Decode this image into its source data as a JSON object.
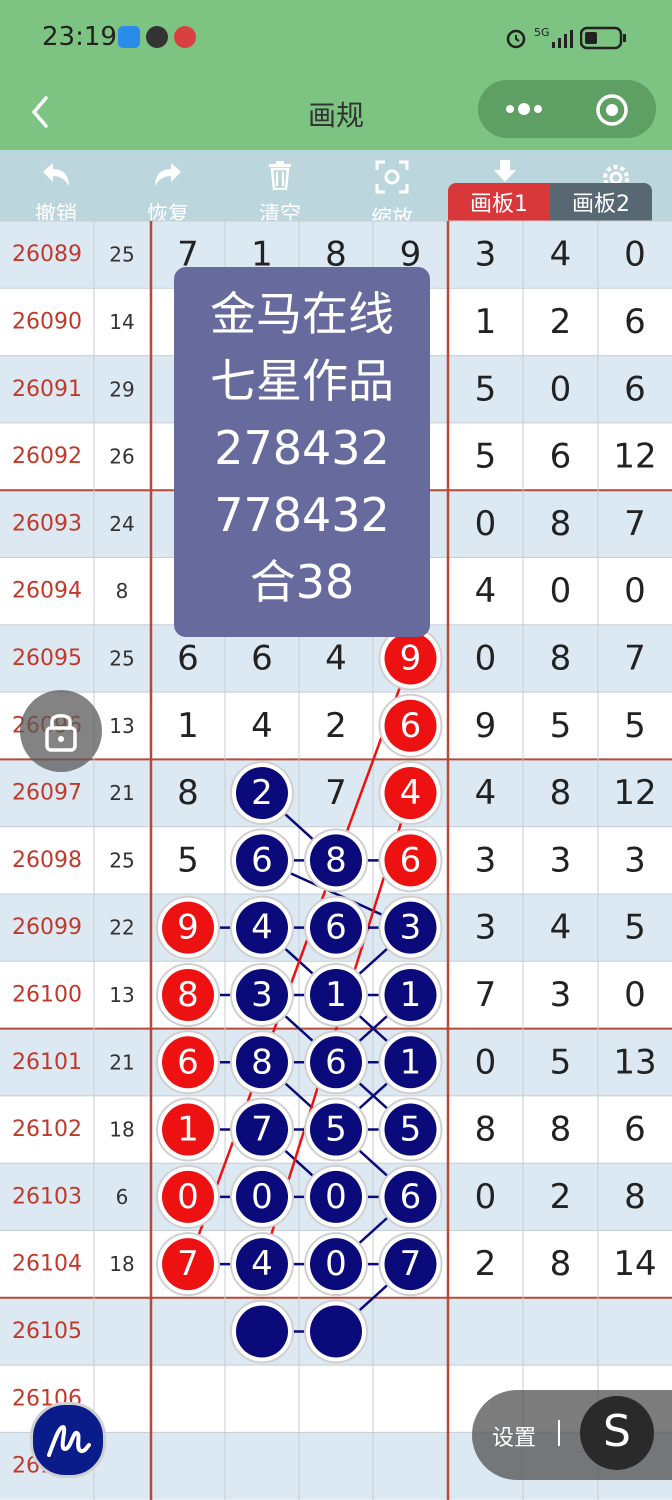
{
  "status": {
    "time": "23:19",
    "network": "5G"
  },
  "nav": {
    "title": "画规",
    "more_icon": "dots-icon",
    "close_icon": "target-icon"
  },
  "toolbar": {
    "undo": "撤销",
    "redo": "恢复",
    "clear": "清空",
    "zoom": "缩放",
    "tab1": "画板1",
    "tab2": "画板2",
    "settings_hidden": "设置"
  },
  "overlay": {
    "lines": [
      "金马在线",
      "七星作品",
      "278432",
      "778432",
      "合38"
    ]
  },
  "rows": [
    {
      "id": "26089",
      "sum": "25",
      "d": [
        "7",
        "1",
        "8",
        "9"
      ],
      "r": [
        "3",
        "4",
        "0"
      ]
    },
    {
      "id": "26090",
      "sum": "14",
      "d": [
        "",
        "",
        "",
        ""
      ],
      "r": [
        "1",
        "2",
        "6"
      ]
    },
    {
      "id": "26091",
      "sum": "29",
      "d": [
        "",
        "",
        "",
        ""
      ],
      "r": [
        "5",
        "0",
        "6"
      ]
    },
    {
      "id": "26092",
      "sum": "26",
      "d": [
        "",
        "",
        "",
        ""
      ],
      "r": [
        "5",
        "6",
        "12"
      ]
    },
    {
      "id": "26093",
      "sum": "24",
      "d": [
        "",
        "",
        "",
        ""
      ],
      "r": [
        "0",
        "8",
        "7"
      ]
    },
    {
      "id": "26094",
      "sum": "8",
      "d": [
        "",
        "",
        "",
        ""
      ],
      "r": [
        "4",
        "0",
        "0"
      ]
    },
    {
      "id": "26095",
      "sum": "25",
      "d": [
        "6",
        "6",
        "4",
        "9"
      ],
      "r": [
        "0",
        "8",
        "7"
      ]
    },
    {
      "id": "26096",
      "sum": "13",
      "d": [
        "1",
        "4",
        "2",
        "6"
      ],
      "r": [
        "9",
        "5",
        "5"
      ]
    },
    {
      "id": "26097",
      "sum": "21",
      "d": [
        "8",
        "2",
        "7",
        "4"
      ],
      "r": [
        "4",
        "8",
        "12"
      ]
    },
    {
      "id": "26098",
      "sum": "25",
      "d": [
        "5",
        "6",
        "8",
        "6"
      ],
      "r": [
        "3",
        "3",
        "3"
      ]
    },
    {
      "id": "26099",
      "sum": "22",
      "d": [
        "9",
        "4",
        "6",
        "3"
      ],
      "r": [
        "3",
        "4",
        "5"
      ]
    },
    {
      "id": "26100",
      "sum": "13",
      "d": [
        "8",
        "3",
        "1",
        "1"
      ],
      "r": [
        "7",
        "3",
        "0"
      ]
    },
    {
      "id": "26101",
      "sum": "21",
      "d": [
        "6",
        "8",
        "6",
        "1"
      ],
      "r": [
        "0",
        "5",
        "13"
      ]
    },
    {
      "id": "26102",
      "sum": "18",
      "d": [
        "1",
        "7",
        "5",
        "5"
      ],
      "r": [
        "8",
        "8",
        "6"
      ]
    },
    {
      "id": "26103",
      "sum": "6",
      "d": [
        "0",
        "0",
        "0",
        "6"
      ],
      "r": [
        "0",
        "2",
        "8"
      ]
    },
    {
      "id": "26104",
      "sum": "18",
      "d": [
        "7",
        "4",
        "0",
        "7"
      ],
      "r": [
        "2",
        "8",
        "14"
      ]
    },
    {
      "id": "26105",
      "sum": "",
      "d": [
        "",
        "",
        "",
        ""
      ],
      "r": [
        "",
        "",
        ""
      ]
    },
    {
      "id": "26106",
      "sum": "",
      "d": [
        "",
        "",
        "",
        ""
      ],
      "r": [
        "",
        "",
        ""
      ]
    },
    {
      "id": "26107",
      "sum": "",
      "d": [
        "",
        "",
        "",
        ""
      ],
      "r": [
        "",
        "",
        ""
      ]
    }
  ],
  "circles": [
    {
      "row": 6,
      "col": 3,
      "color": "red"
    },
    {
      "row": 7,
      "col": 3,
      "color": "red"
    },
    {
      "row": 8,
      "col": 1,
      "color": "navy"
    },
    {
      "row": 8,
      "col": 3,
      "color": "red"
    },
    {
      "row": 9,
      "col": 1,
      "color": "navy"
    },
    {
      "row": 9,
      "col": 2,
      "color": "navy"
    },
    {
      "row": 9,
      "col": 3,
      "color": "red"
    },
    {
      "row": 10,
      "col": 0,
      "color": "red"
    },
    {
      "row": 10,
      "col": 1,
      "color": "navy"
    },
    {
      "row": 10,
      "col": 2,
      "color": "navy"
    },
    {
      "row": 10,
      "col": 3,
      "color": "navy"
    },
    {
      "row": 11,
      "col": 0,
      "color": "red"
    },
    {
      "row": 11,
      "col": 1,
      "color": "navy"
    },
    {
      "row": 11,
      "col": 2,
      "color": "navy"
    },
    {
      "row": 11,
      "col": 3,
      "color": "navy"
    },
    {
      "row": 12,
      "col": 0,
      "color": "red"
    },
    {
      "row": 12,
      "col": 1,
      "color": "navy"
    },
    {
      "row": 12,
      "col": 2,
      "color": "navy"
    },
    {
      "row": 12,
      "col": 3,
      "color": "navy"
    },
    {
      "row": 13,
      "col": 0,
      "color": "red"
    },
    {
      "row": 13,
      "col": 1,
      "color": "navy"
    },
    {
      "row": 13,
      "col": 2,
      "color": "navy"
    },
    {
      "row": 13,
      "col": 3,
      "color": "navy"
    },
    {
      "row": 14,
      "col": 0,
      "color": "red"
    },
    {
      "row": 14,
      "col": 1,
      "color": "navy"
    },
    {
      "row": 14,
      "col": 2,
      "color": "navy"
    },
    {
      "row": 14,
      "col": 3,
      "color": "navy"
    },
    {
      "row": 15,
      "col": 0,
      "color": "red"
    },
    {
      "row": 15,
      "col": 1,
      "color": "navy"
    },
    {
      "row": 15,
      "col": 2,
      "color": "navy"
    },
    {
      "row": 15,
      "col": 3,
      "color": "navy"
    },
    {
      "row": 16,
      "col": 1,
      "color": "navy"
    },
    {
      "row": 16,
      "col": 2,
      "color": "navy"
    }
  ],
  "redLines": [
    [
      [
        3,
        6
      ],
      [
        0,
        15
      ]
    ],
    [
      [
        3,
        8
      ],
      [
        1,
        15
      ]
    ]
  ],
  "blueLines": [
    [
      [
        1,
        8
      ],
      [
        2,
        9
      ]
    ],
    [
      [
        1,
        9
      ],
      [
        3,
        10
      ]
    ],
    [
      [
        1,
        10
      ],
      [
        3,
        12
      ]
    ],
    [
      [
        1,
        11
      ],
      [
        3,
        13
      ]
    ],
    [
      [
        1,
        12
      ],
      [
        3,
        14
      ]
    ],
    [
      [
        1,
        13
      ],
      [
        2,
        14
      ]
    ],
    [
      [
        3,
        10
      ],
      [
        2,
        11
      ]
    ],
    [
      [
        3,
        11
      ],
      [
        2,
        12
      ]
    ],
    [
      [
        3,
        12
      ],
      [
        2,
        13
      ]
    ],
    [
      [
        3,
        14
      ],
      [
        2,
        15
      ]
    ],
    [
      [
        3,
        15
      ],
      [
        2,
        16
      ]
    ]
  ],
  "side": {
    "settings": "设置",
    "s_button": "S"
  },
  "colors": {
    "header_green": "#7dc382",
    "toolbar_blue": "#bcd6de",
    "row_blue": "#dde9f2",
    "red": "#ee1111",
    "navy": "#0a0a7a",
    "id_red": "#c0392b"
  }
}
